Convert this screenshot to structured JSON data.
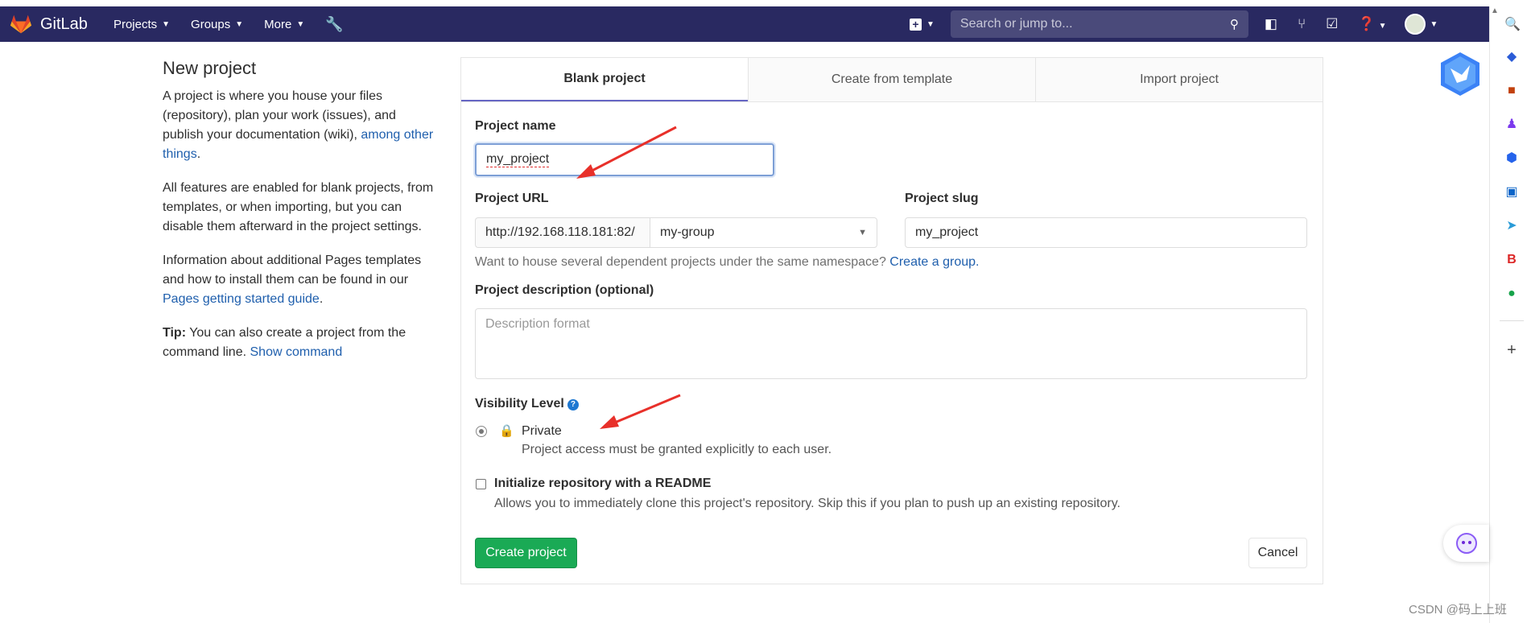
{
  "navbar": {
    "brand": "GitLab",
    "menu": [
      {
        "label": "Projects"
      },
      {
        "label": "Groups"
      },
      {
        "label": "More"
      }
    ],
    "search_placeholder": "Search or jump to..."
  },
  "intro": {
    "title": "New project",
    "p1_text": "A project is where you house your files (repository), plan your work (issues), and publish your documentation (wiki), ",
    "p1_link": "among other things",
    "p1_end": ".",
    "p2": "All features are enabled for blank projects, from templates, or when importing, but you can disable them afterward in the project settings.",
    "p3_text": "Information about additional Pages templates and how to install them can be found in our ",
    "p3_link": "Pages getting started guide",
    "p3_end": ".",
    "tip_label": "Tip:",
    "tip_text": " You can also create a project from the command line. ",
    "tip_link": "Show command"
  },
  "tabs": [
    {
      "label": "Blank project",
      "active": true
    },
    {
      "label": "Create from template",
      "active": false
    },
    {
      "label": "Import project",
      "active": false
    }
  ],
  "form": {
    "project_name_label": "Project name",
    "project_name_value": "my_project",
    "project_url_label": "Project URL",
    "url_prefix": "http://192.168.118.181:82/",
    "namespace_value": "my-group",
    "project_slug_label": "Project slug",
    "project_slug_value": "my_project",
    "namespace_help": "Want to house several dependent projects under the same namespace? ",
    "namespace_help_link": "Create a group.",
    "description_label": "Project description (optional)",
    "description_placeholder": "Description format",
    "visibility_label": "Visibility Level",
    "visibility_option": "Private",
    "visibility_desc": "Project access must be granted explicitly to each user.",
    "readme_label": "Initialize repository with a README",
    "readme_desc": "Allows you to immediately clone this project's repository. Skip this if you plan to push up an existing repository.",
    "create_button": "Create project",
    "cancel_button": "Cancel"
  },
  "watermark": "CSDN @码上上班",
  "colors": {
    "navbar": "#292961",
    "primary_button": "#1aaa55",
    "link": "#1f5fad",
    "tab_active_border": "#6666c4",
    "arrow": "#e8302a"
  }
}
